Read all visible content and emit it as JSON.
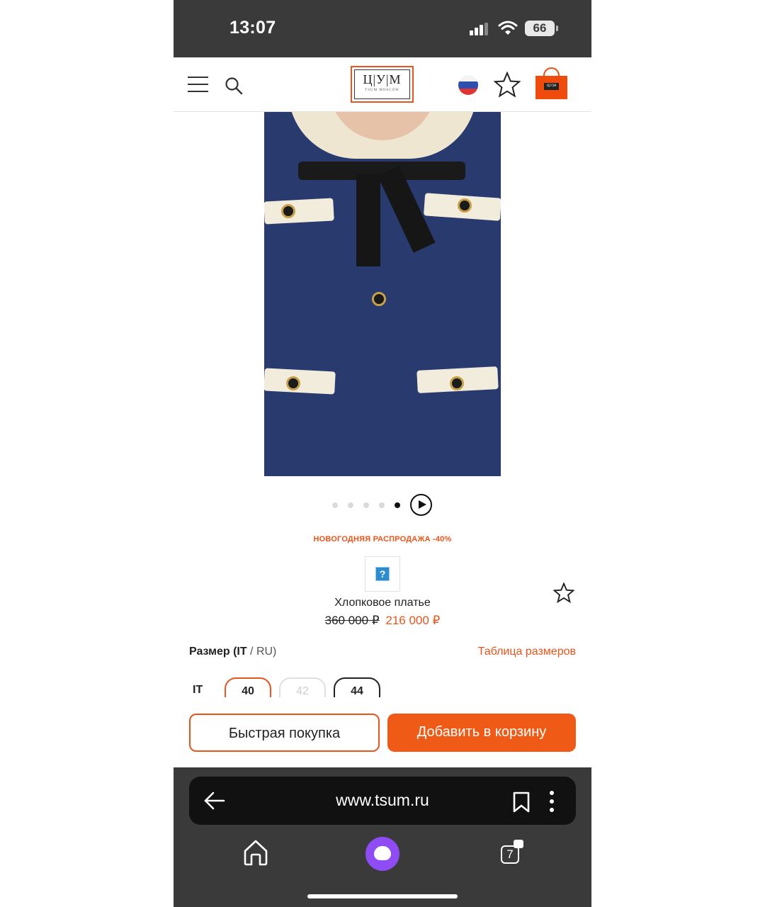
{
  "status_bar": {
    "time": "13:07",
    "battery": "66"
  },
  "header": {
    "logo_main": "Ц|У|М",
    "logo_sub": "TSUM MOSCOW",
    "cart_logo": "Ц|У|М",
    "accent_color": "#e8551c"
  },
  "gallery": {
    "image_count": 5,
    "active_index": 5
  },
  "product": {
    "promo": "НОВОГОДНЯЯ РАСПРОДАЖА -40%",
    "brand_placeholder": "?",
    "name": "Хлопковое платье",
    "old_price": "360 000 ₽",
    "new_price": "216 000 ₽"
  },
  "sizes": {
    "label_bold": "Размер (IT",
    "label_rest": " / RU)",
    "table_link": "Таблица размеров",
    "system": "IT",
    "options": [
      {
        "value": "40",
        "state": "selected"
      },
      {
        "value": "42",
        "state": "unavailable"
      },
      {
        "value": "44",
        "state": "available"
      }
    ]
  },
  "actions": {
    "quick_buy": "Быстрая покупка",
    "add_to_cart": "Добавить в корзину"
  },
  "browser": {
    "url": "www.tsum.ru",
    "tabs_count": "7"
  }
}
